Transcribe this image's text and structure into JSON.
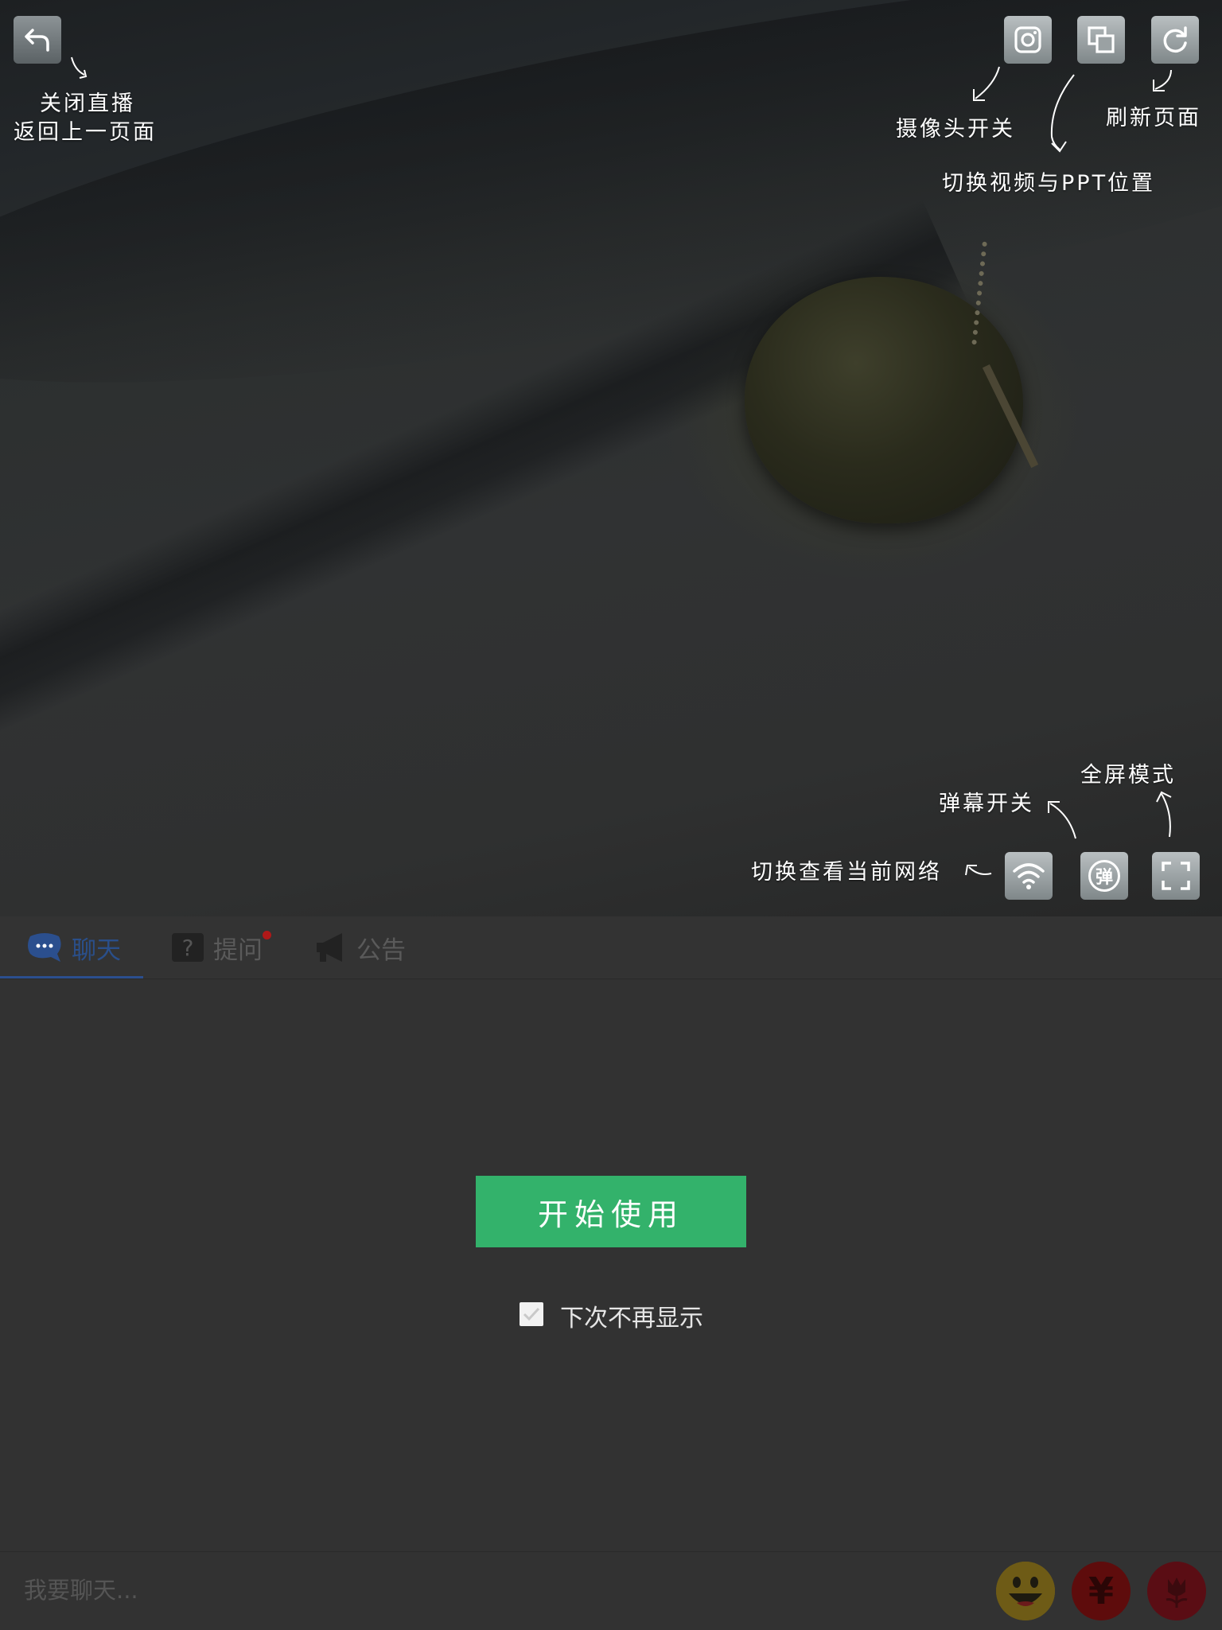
{
  "video": {
    "tips": {
      "back": [
        "关闭直播",
        "返回上一页面"
      ],
      "camera": "摄像头开关",
      "refresh": "刷新页面",
      "swap": "切换视频与PPT位置",
      "fullscreen": "全屏模式",
      "danmaku": "弹幕开关",
      "network": "切换查看当前网络"
    },
    "danmaku_button_label": "弹"
  },
  "tabs": [
    {
      "label": "聊天",
      "icon": "chat-bubble-icon",
      "active": true
    },
    {
      "label": "提问",
      "icon": "question-icon",
      "active": false,
      "has_notification": true
    },
    {
      "label": "公告",
      "icon": "megaphone-icon",
      "active": false
    }
  ],
  "main": {
    "start_button": "开始使用",
    "dont_show_again": "下次不再显示",
    "dont_show_again_checked": true
  },
  "chat": {
    "placeholder": "我要聊天...",
    "reward_symbol": "¥"
  },
  "colors": {
    "accent_green": "#33b26b",
    "active_tab": "#2b4f8e",
    "notification_dot": "#b01818"
  }
}
